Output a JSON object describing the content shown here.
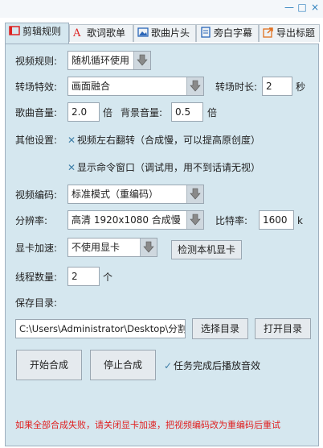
{
  "window": {
    "min": "—",
    "max": "□",
    "close": "×"
  },
  "tabs": [
    {
      "label": "剪辑规则"
    },
    {
      "label": "歌词歌单"
    },
    {
      "label": "歌曲片头"
    },
    {
      "label": "旁白字幕"
    },
    {
      "label": "导出标题"
    }
  ],
  "form": {
    "video_rule_label": "视频规则:",
    "video_rule_value": "随机循环使用",
    "transition_label": "转场特效:",
    "transition_value": "画面融合",
    "transition_duration_label": "转场时长:",
    "transition_duration_value": "2",
    "seconds_unit": "秒",
    "song_volume_label": "歌曲音量:",
    "song_volume_value": "2.0",
    "times_unit": "倍",
    "bg_volume_label": "背景音量:",
    "bg_volume_value": "0.5",
    "other_settings_label": "其他设置:",
    "flip_label": "视频左右翻转（合成慢，可以提高原创度）",
    "cmd_window_label": "显示命令窗口（调试用，用不到话请无视）",
    "encoding_label": "视频编码:",
    "encoding_value": "标准模式（重编码）",
    "resolution_label": "分辨率:",
    "resolution_value": "高清 1920x1080 合成慢",
    "bitrate_label": "比特率:",
    "bitrate_value": "1600",
    "bitrate_unit": "k",
    "gpu_label": "显卡加速:",
    "gpu_value": "不使用显卡",
    "detect_gpu_button": "检测本机显卡",
    "threads_label": "线程数量:",
    "threads_value": "2",
    "threads_unit": "个",
    "save_dir_label": "保存目录:",
    "save_dir_value": "C:\\Users\\Administrator\\Desktop\\分割",
    "choose_dir_button": "选择目录",
    "open_dir_button": "打开目录",
    "start_button": "开始合成",
    "stop_button": "停止合成",
    "sound_on_finish_label": "任务完成后播放音效",
    "warning": "如果全部合成失败，请关闭显卡加速，把视频编码改为重编码后重试"
  },
  "colors": {
    "panel_bg": "#d5e7ef",
    "warning": "#e02020",
    "accent": "#2d7fbd"
  },
  "icons": {
    "combo_arrow": "down-arrow-icon",
    "check": "check-icon",
    "cross": "x-icon"
  }
}
